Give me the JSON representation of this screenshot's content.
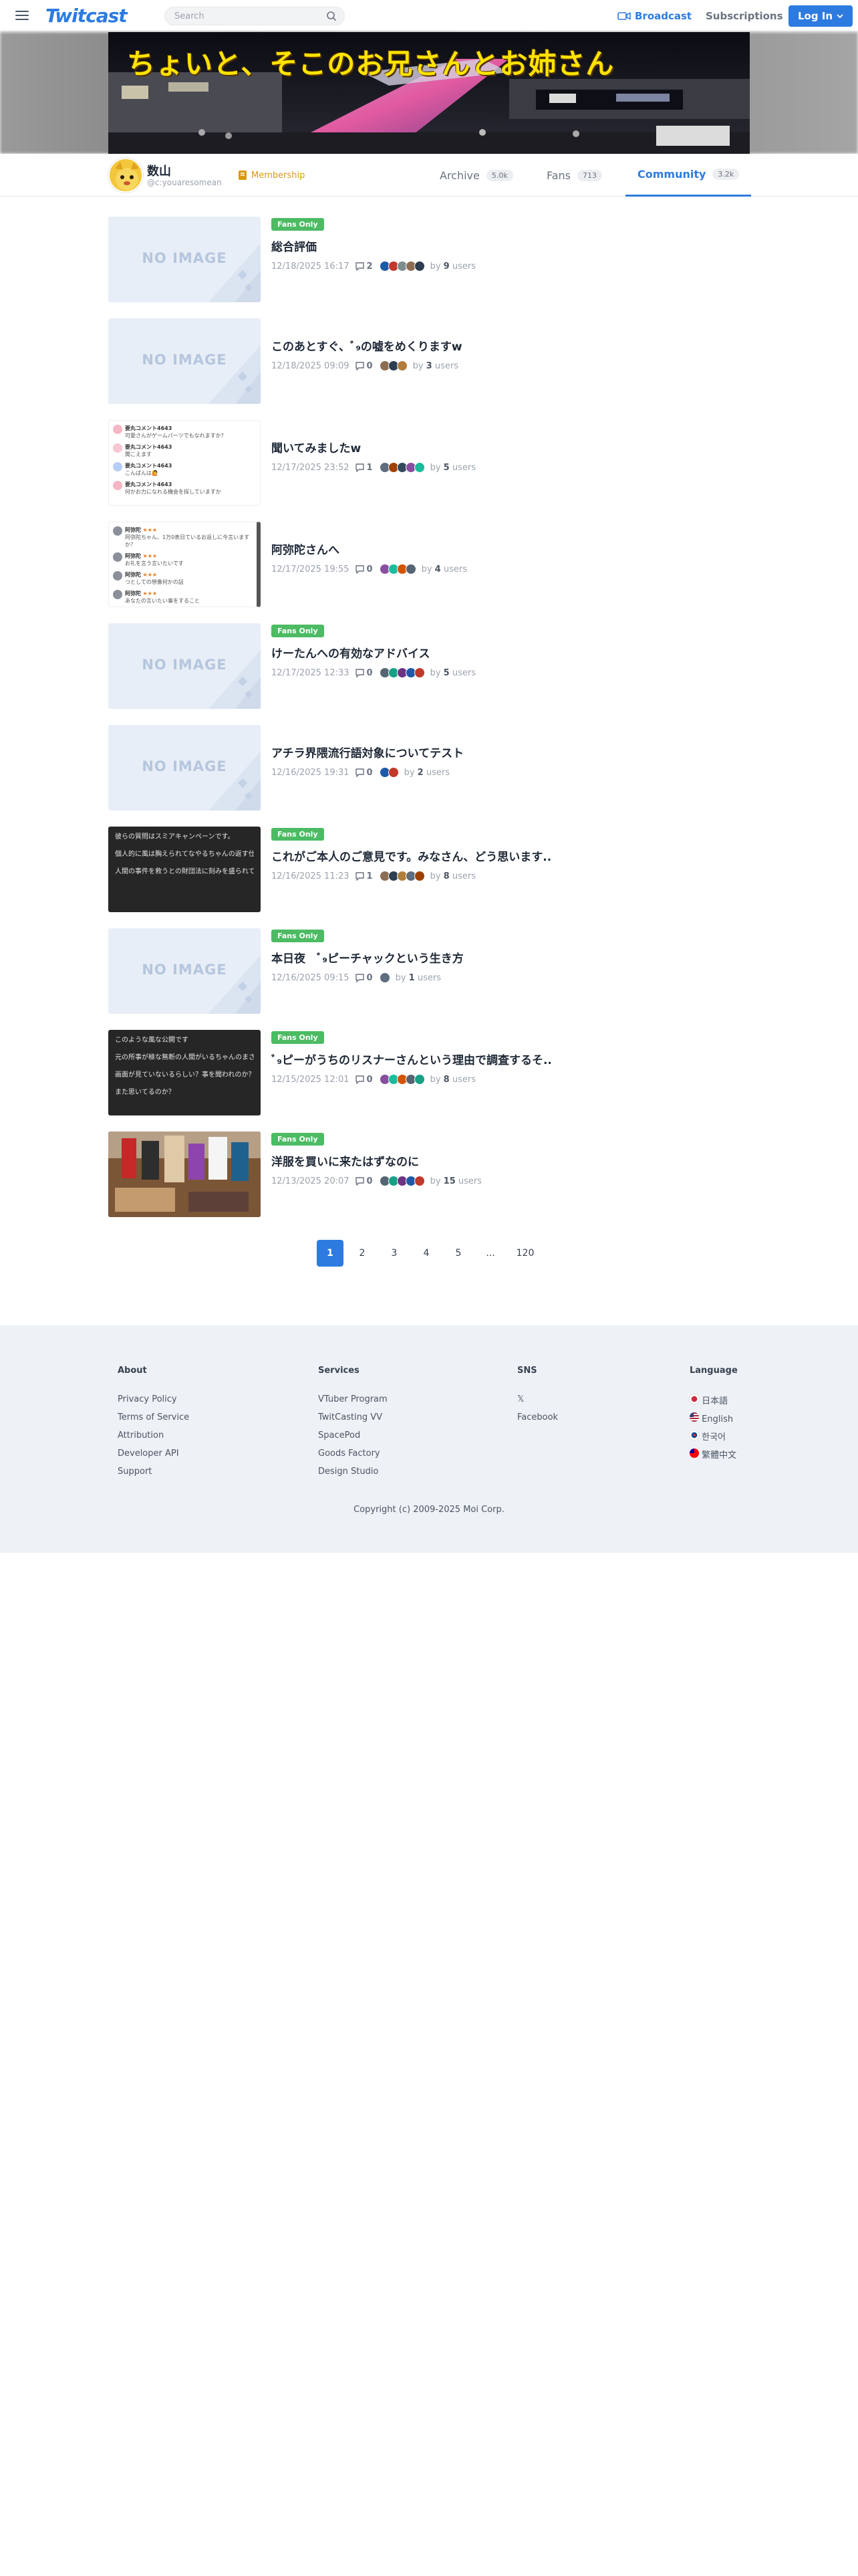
{
  "header": {
    "logo": "Twitcast",
    "search_placeholder": "Search",
    "broadcast": "Broadcast",
    "subscriptions": "Subscriptions",
    "login": "Log In"
  },
  "banner": {
    "text": "ちょいと、そこのお兄さんとお姉さん"
  },
  "profile": {
    "name": "数山",
    "handle": "@c:youaresomean",
    "membership": "Membership",
    "tabs": [
      {
        "label": "Archive",
        "count": "5.0k"
      },
      {
        "label": "Fans",
        "count": "713"
      },
      {
        "label": "Community",
        "count": "3.2k"
      }
    ]
  },
  "posts": [
    {
      "fans_only": "Fans Only",
      "title": "総合評価",
      "date": "12/18/2025 16:17",
      "comments": "2",
      "by": "by",
      "users": "9",
      "users_label": "users"
    },
    {
      "fans_only": "",
      "title": "このあとすぐ、ﾞ₉の嘘をめくりますw",
      "date": "12/18/2025 09:09",
      "comments": "0",
      "by": "by",
      "users": "3",
      "users_label": "users"
    },
    {
      "fans_only": "",
      "title": "聞いてみましたw",
      "date": "12/17/2025 23:52",
      "comments": "1",
      "by": "by",
      "users": "5",
      "users_label": "users"
    },
    {
      "fans_only": "",
      "title": "阿弥陀さんへ",
      "date": "12/17/2025 19:55",
      "comments": "0",
      "by": "by",
      "users": "4",
      "users_label": "users"
    },
    {
      "fans_only": "Fans Only",
      "title": "けーたんへの有効なアドバイス",
      "date": "12/17/2025 12:33",
      "comments": "0",
      "by": "by",
      "users": "5",
      "users_label": "users"
    },
    {
      "fans_only": "",
      "title": "アチラ界隈流行語対象についてテスト",
      "date": "12/16/2025 19:31",
      "comments": "0",
      "by": "by",
      "users": "2",
      "users_label": "users"
    },
    {
      "fans_only": "Fans Only",
      "title": "これがご本人のご意見です。みなさん、どう思います..",
      "date": "12/16/2025 11:23",
      "comments": "1",
      "by": "by",
      "users": "8",
      "users_label": "users"
    },
    {
      "fans_only": "Fans Only",
      "title": "本日夜　ﾞ₉ピーチャックという生き方",
      "date": "12/16/2025 09:15",
      "comments": "0",
      "by": "by",
      "users": "1",
      "users_label": "users"
    },
    {
      "fans_only": "Fans Only",
      "title": "ﾞ₉ピーがうちのリスナーさんという理由で調査するそ..",
      "date": "12/15/2025 12:01",
      "comments": "0",
      "by": "by",
      "users": "8",
      "users_label": "users"
    },
    {
      "fans_only": "Fans Only",
      "title": "洋服を買いに来たはずなのに",
      "date": "12/13/2025 20:07",
      "comments": "0",
      "by": "by",
      "users": "15",
      "users_label": "users"
    }
  ],
  "thumbs": {
    "no_image": "NO IMAGE",
    "comments_thumb": [
      {
        "name": "要丸コメント4643",
        "text": "可愛さんがゲームパーツでもなれますか？"
      },
      {
        "name": "要丸コメント4643",
        "text": "聞こえます"
      },
      {
        "name": "要丸コメント4643",
        "text": "こんばんは🙋"
      },
      {
        "name": "要丸コメント4643",
        "text": "何かお力になれる機会を探していますか"
      }
    ],
    "thread_thumb": [
      {
        "name": "阿弥陀",
        "text": "阿弥陀ちゃん、1万0表日ているお返しに今言いますか？"
      },
      {
        "name": "阿弥陀",
        "text": "お礼を言う言いたいです"
      },
      {
        "name": "阿弥陀",
        "text": "つとしての想像何かの話"
      },
      {
        "name": "阿弥陀",
        "text": "あなたの言いたい事をすること"
      }
    ],
    "dark_thumb_1": [
      "彼らの質問はスミアキャンペーンです。",
      "個人的に風は胸えられてなやるちゃんの返す仕組です。",
      "人間の事件を救うとの財団法に刻みを盛られて協議で"
    ],
    "dark_thumb_2": [
      "このような風な公開です",
      "元の所事が極な無断の人間がいるちゃんのまさの可能後",
      "画面が見ていないるらしい？事を聞われのか？w",
      "また思いてるのか？"
    ]
  },
  "pagination": [
    "1",
    "2",
    "3",
    "4",
    "5",
    "...",
    "120"
  ],
  "footer": {
    "about": {
      "heading": "About",
      "links": [
        "Privacy Policy",
        "Terms of Service",
        "Attribution",
        "Developer API",
        "Support"
      ]
    },
    "services": {
      "heading": "Services",
      "links": [
        "VTuber Program",
        "TwitCasting VV",
        "SpacePod",
        "Goods Factory",
        "Design Studio"
      ]
    },
    "sns": {
      "heading": "SNS",
      "links": [
        "𝕏",
        "Facebook"
      ]
    },
    "language": {
      "heading": "Language",
      "links": [
        "日本語",
        "English",
        "한국어",
        "繁體中文"
      ]
    },
    "copyright": "Copyright (c) 2009-2025 Moi Corp."
  },
  "colors": {
    "accent": "#2d7be0",
    "fans_only_badge": "#4cbb63",
    "membership": "#d89a0c"
  }
}
